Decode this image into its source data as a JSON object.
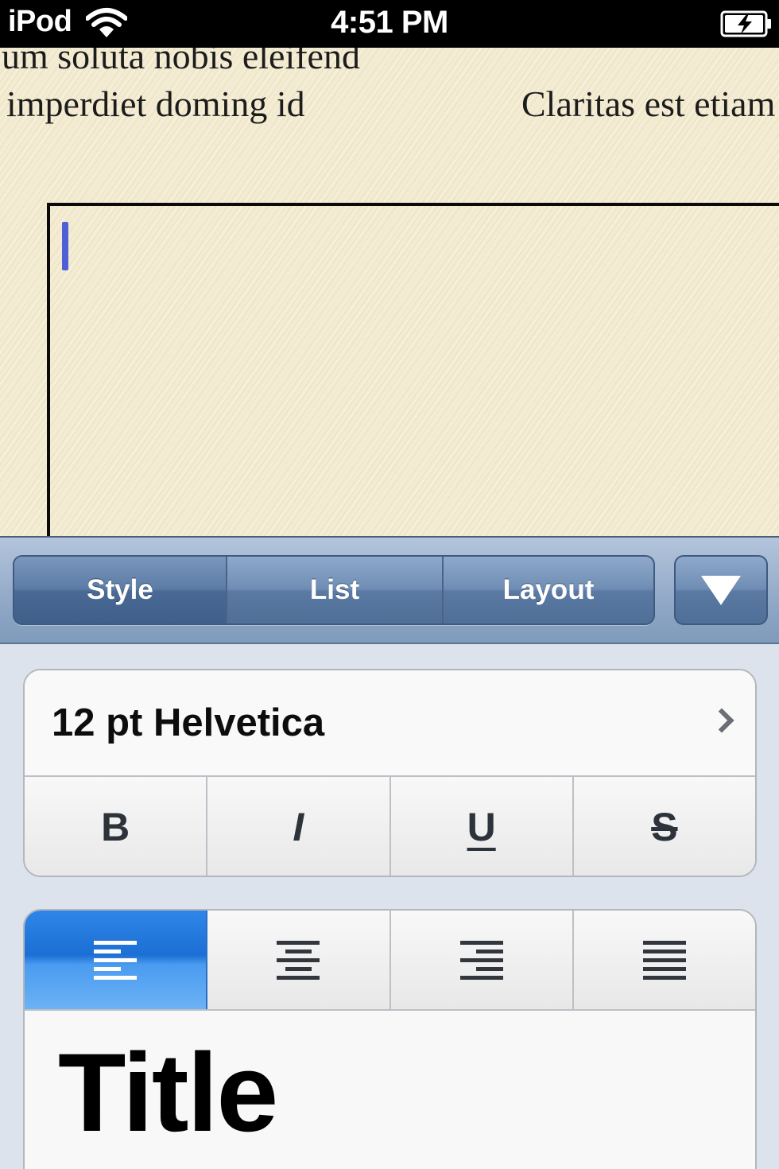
{
  "status_bar": {
    "carrier": "iPod",
    "time": "4:51 PM",
    "wifi_icon": "wifi-icon",
    "battery_icon": "battery-charging-icon"
  },
  "document": {
    "lines": [
      "um soluta nobis eleifend",
      "imperdiet doming id",
      "Claritas est etiam"
    ],
    "text_box_value": ""
  },
  "toolbar": {
    "tabs": [
      {
        "label": "Style",
        "active": true
      },
      {
        "label": "List",
        "active": false
      },
      {
        "label": "Layout",
        "active": false
      }
    ],
    "dismiss_icon": "triangle-down-icon"
  },
  "format_panel": {
    "font_label": "12 pt Helvetica",
    "style_buttons": [
      {
        "label": "B",
        "icon": "bold-icon"
      },
      {
        "label": "I",
        "icon": "italic-icon"
      },
      {
        "label": "U",
        "icon": "underline-icon"
      },
      {
        "label": "S",
        "icon": "strikethrough-icon"
      }
    ],
    "alignment": {
      "options": [
        "align-left-icon",
        "align-center-icon",
        "align-right-icon",
        "align-justify-icon"
      ],
      "selected": "align-left-icon"
    },
    "paragraph_style": "Title"
  },
  "colors": {
    "selected_alignment": "#1c6fd4",
    "toolbar": "#6f8db4",
    "cursor": "#4f5fd6"
  }
}
